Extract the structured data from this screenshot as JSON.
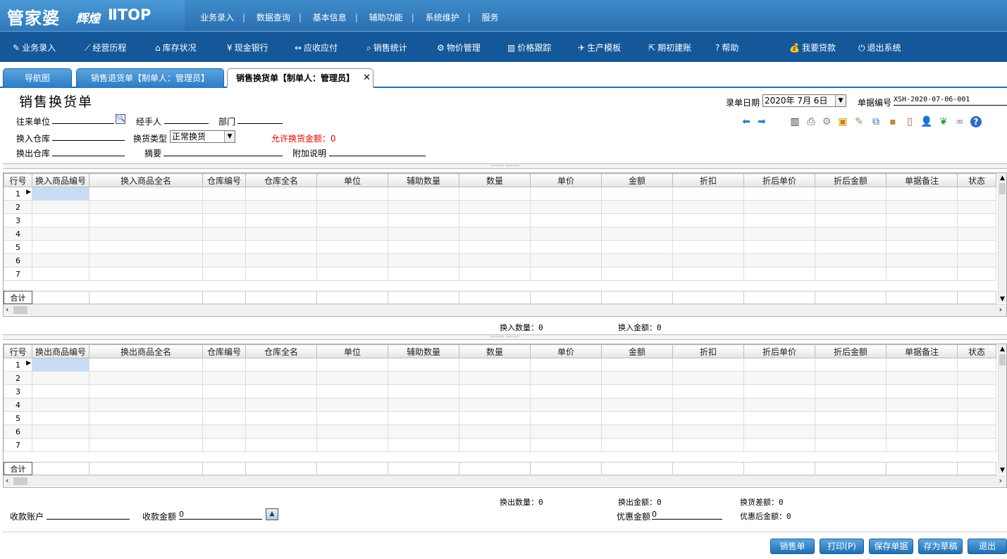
{
  "app": {
    "brand": "管家婆",
    "edition": "辉煌",
    "edition_suffix": "ⅡTOP"
  },
  "top_menu": [
    "业务录入",
    "数据查询",
    "基本信息",
    "辅助功能",
    "系统维护",
    "服务"
  ],
  "nav": [
    {
      "label": "业务录入",
      "icon": "document-edit-icon",
      "glyph": "✎"
    },
    {
      "label": "经营历程",
      "icon": "line-chart-icon",
      "glyph": "⟋"
    },
    {
      "label": "库存状况",
      "icon": "home-icon",
      "glyph": "⌂"
    },
    {
      "label": "现金银行",
      "icon": "yen-icon",
      "glyph": "¥"
    },
    {
      "label": "应收应付",
      "icon": "exchange-icon",
      "glyph": "↔"
    },
    {
      "label": "销售统计",
      "icon": "search-icon",
      "glyph": "⌕"
    },
    {
      "label": "物价管理",
      "icon": "gear-icon",
      "glyph": "⚙"
    },
    {
      "label": "价格跟踪",
      "icon": "bar-chart-icon",
      "glyph": "▥"
    },
    {
      "label": "生产模板",
      "icon": "wrench-icon",
      "glyph": "✈"
    },
    {
      "label": "期初建账",
      "icon": "external-link-icon",
      "glyph": "⇱"
    },
    {
      "label": "帮助",
      "icon": "question-icon",
      "glyph": "?"
    },
    {
      "label": "我要贷款",
      "icon": "money-bag-icon",
      "glyph": "💰"
    },
    {
      "label": "退出系统",
      "icon": "power-icon",
      "glyph": "⏻"
    }
  ],
  "tabs": [
    {
      "label": "导航图"
    },
    {
      "label": "销售退货单【制单人：管理员】"
    },
    {
      "label": "销售换货单【制单人：管理员】"
    }
  ],
  "tab_close": "✕",
  "form": {
    "title": "销售换货单",
    "partner_label": "往来单位",
    "handler_label": "经手人",
    "dept_label": "部门",
    "in_warehouse_label": "换入仓库",
    "exchange_type_label": "换货类型",
    "exchange_type_value": "正常换货",
    "allow_amount_label": "允许换货金额：0",
    "out_warehouse_label": "换出仓库",
    "summary_label": "摘要",
    "note_label": "附加说明",
    "date_label": "录单日期",
    "date_value": "2020年 7月 6日",
    "bill_no_label": "单据编号",
    "bill_no_value": "XSH-2020-07-06-001"
  },
  "grid_in": {
    "headers": [
      "行号",
      "换入商品编号",
      "换入商品全名",
      "仓库编号",
      "仓库全名",
      "单位",
      "辅助数量",
      "数量",
      "单价",
      "金额",
      "折扣",
      "折后单价",
      "折后金额",
      "单据备注",
      "状态"
    ],
    "rows": [
      "1",
      "2",
      "3",
      "4",
      "5",
      "6",
      "7"
    ],
    "total_label": "合计"
  },
  "grid_out": {
    "headers": [
      "行号",
      "换出商品编号",
      "换出商品全名",
      "仓库编号",
      "仓库全名",
      "单位",
      "辅助数量",
      "数量",
      "单价",
      "金额",
      "折扣",
      "折后单价",
      "折后金额",
      "单据备注",
      "状态"
    ],
    "rows": [
      "1",
      "2",
      "3",
      "4",
      "5",
      "6",
      "7"
    ],
    "total_label": "合计"
  },
  "totals": {
    "in_qty": "换入数量：0",
    "in_amt": "换入金额：0",
    "out_qty": "换出数量：0",
    "out_amt": "换出金额：0",
    "diff": "换货差额：0",
    "discount_label": "优惠金额",
    "discount_value": "0",
    "after_discount": "优惠后金额：0",
    "account_label": "收款账户",
    "receive_label": "收款金额",
    "receive_value": "0"
  },
  "buttons": [
    "销售单",
    "打印(P)",
    "保存单据",
    "存为草稿",
    "退出"
  ],
  "splitter_text": "›››››››› ››››››››"
}
